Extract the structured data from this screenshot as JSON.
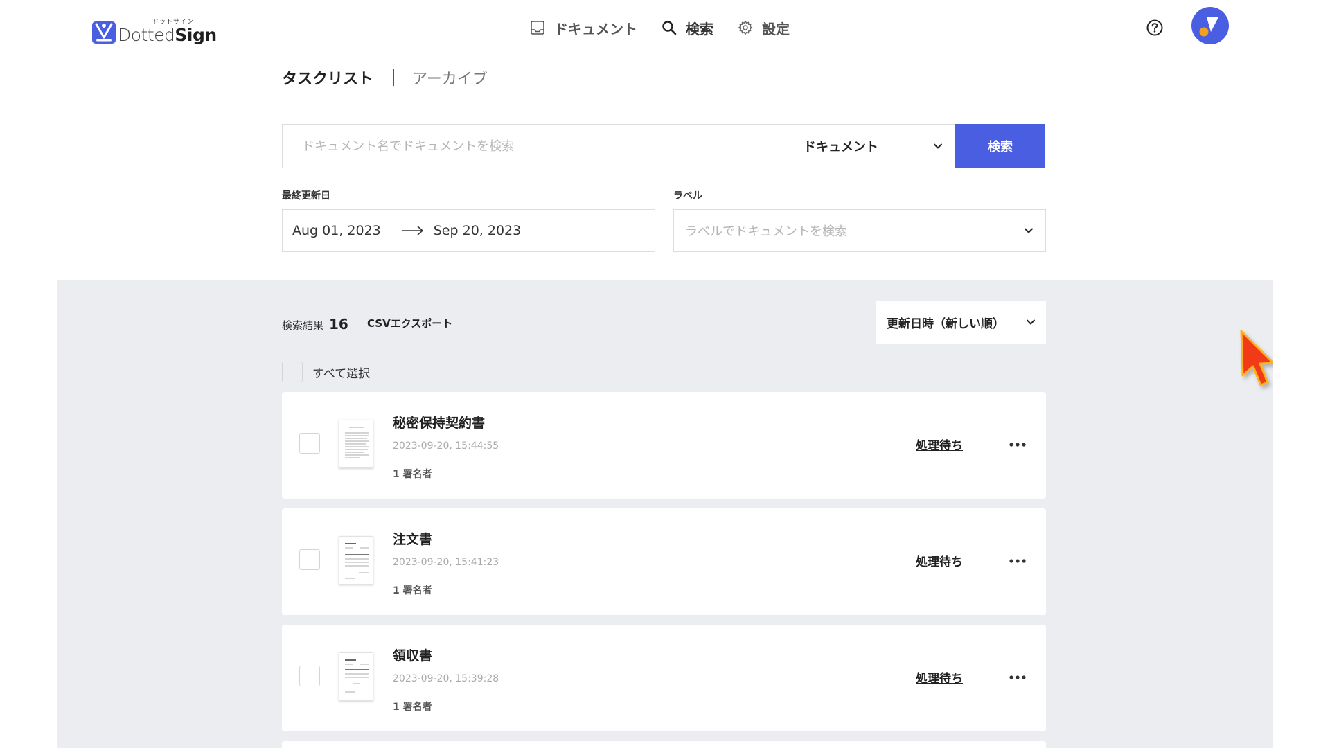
{
  "header": {
    "logo_ruby": "ドットサイン",
    "logo_dotted": "Dotted",
    "logo_sign": "Sign",
    "nav": [
      {
        "label": "ドキュメント",
        "icon": "inbox-icon"
      },
      {
        "label": "検索",
        "icon": "search-icon"
      },
      {
        "label": "設定",
        "icon": "gear-icon"
      }
    ],
    "help_icon": "help-icon",
    "accent_color": "#4a5ee2"
  },
  "tabs": {
    "active": "タスクリスト",
    "inactive": "アーカイブ"
  },
  "search": {
    "placeholder": "ドキュメント名でドキュメントを検索",
    "value": "",
    "type_select": "ドキュメント",
    "button": "検索"
  },
  "filters": {
    "date_label": "最終更新日",
    "date_from": "Aug 01, 2023",
    "date_to": "Sep 20, 2023",
    "label_label": "ラベル",
    "label_placeholder": "ラベルでドキュメントを検索"
  },
  "results": {
    "count_label": "検索結果",
    "count": "16",
    "csv_export": "CSVエクスポート",
    "sort": "更新日時（新しい順）",
    "select_all": "すべて選択",
    "documents": [
      {
        "title": "秘密保持契約書",
        "time": "2023-09-20, 15:44:55",
        "signers": "1 署名者",
        "status": "処理待ち"
      },
      {
        "title": "注文書",
        "time": "2023-09-20, 15:41:23",
        "signers": "1 署名者",
        "status": "処理待ち"
      },
      {
        "title": "領収書",
        "time": "2023-09-20, 15:39:28",
        "signers": "1 署名者",
        "status": "処理待ち"
      }
    ]
  }
}
